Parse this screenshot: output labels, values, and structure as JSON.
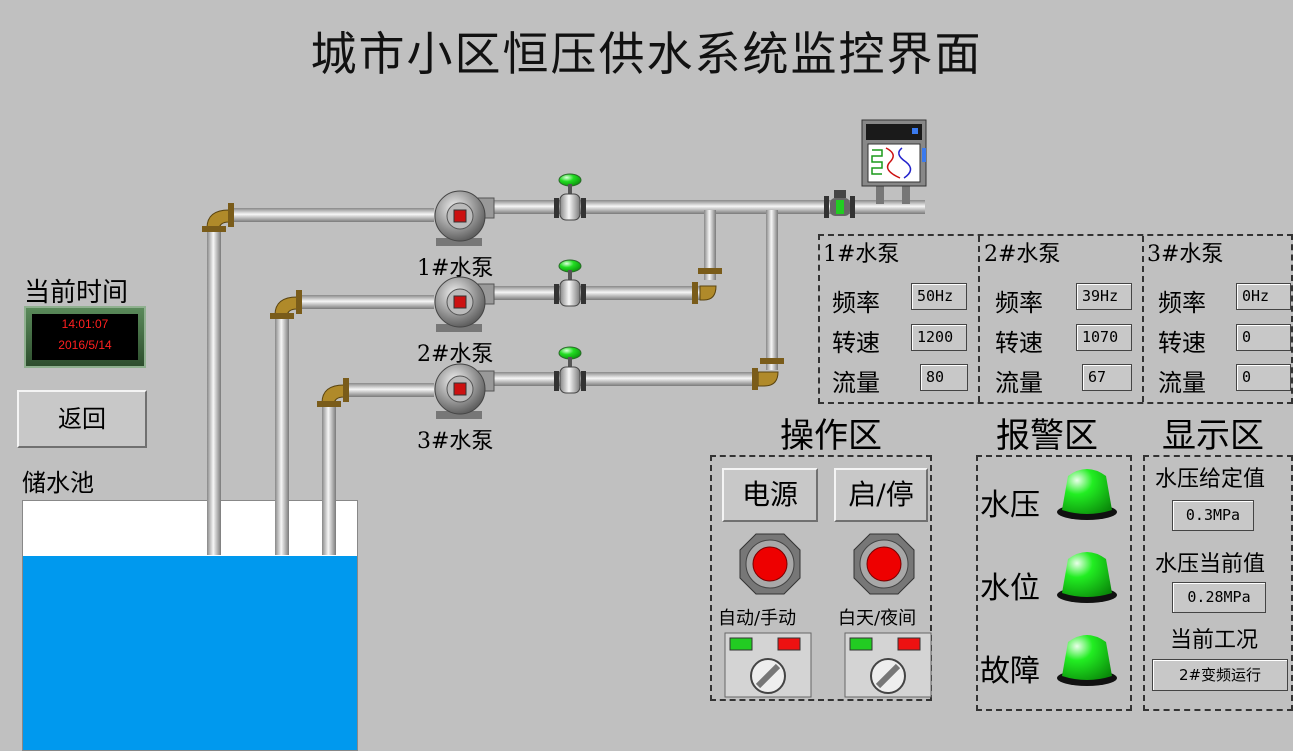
{
  "title": "城市小区恒压供水系统监控界面",
  "time_label": "当前时间",
  "clock": {
    "time": "14:01:07",
    "date": "2016/5/14"
  },
  "back_button": "返回",
  "tank_label": "储水池",
  "tank_level": 0.78,
  "pumps": [
    {
      "name": "1#水泵",
      "freq": "50Hz",
      "speed": "1200",
      "flow": "80"
    },
    {
      "name": "2#水泵",
      "freq": "39Hz",
      "speed": "1070",
      "flow": "67"
    },
    {
      "name": "3#水泵",
      "freq": "0Hz",
      "speed": "0",
      "flow": "0"
    }
  ],
  "stat_labels": {
    "freq": "频率",
    "speed": "转速",
    "flow": "流量"
  },
  "operation": {
    "title": "操作区",
    "power_button": "电源",
    "start_stop_button": "启/停",
    "mode_switch_label": "自动/手动",
    "daynight_switch_label": "白天/夜间"
  },
  "alarm": {
    "title": "报警区",
    "items": [
      "水压",
      "水位",
      "故障"
    ]
  },
  "display": {
    "title": "显示区",
    "set_pressure_label": "水压给定值",
    "set_pressure": "0.3MPa",
    "cur_pressure_label": "水压当前值",
    "cur_pressure": "0.28MPa",
    "condition_label": "当前工况",
    "condition": "2#变频运行"
  },
  "colors": {
    "water": "#0099ee",
    "alarm_light": "#22dd22",
    "button_red": "#ee0000",
    "clock_text": "#ff2020"
  }
}
